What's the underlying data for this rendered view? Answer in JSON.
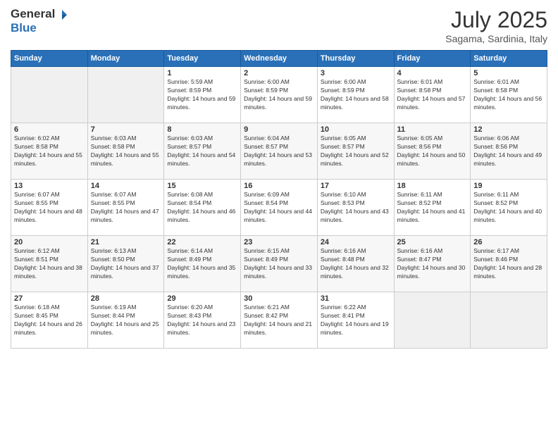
{
  "header": {
    "logo": {
      "general": "General",
      "blue": "Blue"
    },
    "title": "July 2025",
    "subtitle": "Sagama, Sardinia, Italy"
  },
  "calendar": {
    "days": [
      "Sunday",
      "Monday",
      "Tuesday",
      "Wednesday",
      "Thursday",
      "Friday",
      "Saturday"
    ],
    "weeks": [
      [
        {
          "day": null
        },
        {
          "day": null
        },
        {
          "day": 1,
          "sunrise": "5:59 AM",
          "sunset": "8:59 PM",
          "daylight": "14 hours and 59 minutes."
        },
        {
          "day": 2,
          "sunrise": "6:00 AM",
          "sunset": "8:59 PM",
          "daylight": "14 hours and 59 minutes."
        },
        {
          "day": 3,
          "sunrise": "6:00 AM",
          "sunset": "8:59 PM",
          "daylight": "14 hours and 58 minutes."
        },
        {
          "day": 4,
          "sunrise": "6:01 AM",
          "sunset": "8:58 PM",
          "daylight": "14 hours and 57 minutes."
        },
        {
          "day": 5,
          "sunrise": "6:01 AM",
          "sunset": "8:58 PM",
          "daylight": "14 hours and 56 minutes."
        }
      ],
      [
        {
          "day": 6,
          "sunrise": "6:02 AM",
          "sunset": "8:58 PM",
          "daylight": "14 hours and 55 minutes."
        },
        {
          "day": 7,
          "sunrise": "6:03 AM",
          "sunset": "8:58 PM",
          "daylight": "14 hours and 55 minutes."
        },
        {
          "day": 8,
          "sunrise": "6:03 AM",
          "sunset": "8:57 PM",
          "daylight": "14 hours and 54 minutes."
        },
        {
          "day": 9,
          "sunrise": "6:04 AM",
          "sunset": "8:57 PM",
          "daylight": "14 hours and 53 minutes."
        },
        {
          "day": 10,
          "sunrise": "6:05 AM",
          "sunset": "8:57 PM",
          "daylight": "14 hours and 52 minutes."
        },
        {
          "day": 11,
          "sunrise": "6:05 AM",
          "sunset": "8:56 PM",
          "daylight": "14 hours and 50 minutes."
        },
        {
          "day": 12,
          "sunrise": "6:06 AM",
          "sunset": "8:56 PM",
          "daylight": "14 hours and 49 minutes."
        }
      ],
      [
        {
          "day": 13,
          "sunrise": "6:07 AM",
          "sunset": "8:55 PM",
          "daylight": "14 hours and 48 minutes."
        },
        {
          "day": 14,
          "sunrise": "6:07 AM",
          "sunset": "8:55 PM",
          "daylight": "14 hours and 47 minutes."
        },
        {
          "day": 15,
          "sunrise": "6:08 AM",
          "sunset": "8:54 PM",
          "daylight": "14 hours and 46 minutes."
        },
        {
          "day": 16,
          "sunrise": "6:09 AM",
          "sunset": "8:54 PM",
          "daylight": "14 hours and 44 minutes."
        },
        {
          "day": 17,
          "sunrise": "6:10 AM",
          "sunset": "8:53 PM",
          "daylight": "14 hours and 43 minutes."
        },
        {
          "day": 18,
          "sunrise": "6:11 AM",
          "sunset": "8:52 PM",
          "daylight": "14 hours and 41 minutes."
        },
        {
          "day": 19,
          "sunrise": "6:11 AM",
          "sunset": "8:52 PM",
          "daylight": "14 hours and 40 minutes."
        }
      ],
      [
        {
          "day": 20,
          "sunrise": "6:12 AM",
          "sunset": "8:51 PM",
          "daylight": "14 hours and 38 minutes."
        },
        {
          "day": 21,
          "sunrise": "6:13 AM",
          "sunset": "8:50 PM",
          "daylight": "14 hours and 37 minutes."
        },
        {
          "day": 22,
          "sunrise": "6:14 AM",
          "sunset": "8:49 PM",
          "daylight": "14 hours and 35 minutes."
        },
        {
          "day": 23,
          "sunrise": "6:15 AM",
          "sunset": "8:49 PM",
          "daylight": "14 hours and 33 minutes."
        },
        {
          "day": 24,
          "sunrise": "6:16 AM",
          "sunset": "8:48 PM",
          "daylight": "14 hours and 32 minutes."
        },
        {
          "day": 25,
          "sunrise": "6:16 AM",
          "sunset": "8:47 PM",
          "daylight": "14 hours and 30 minutes."
        },
        {
          "day": 26,
          "sunrise": "6:17 AM",
          "sunset": "8:46 PM",
          "daylight": "14 hours and 28 minutes."
        }
      ],
      [
        {
          "day": 27,
          "sunrise": "6:18 AM",
          "sunset": "8:45 PM",
          "daylight": "14 hours and 26 minutes."
        },
        {
          "day": 28,
          "sunrise": "6:19 AM",
          "sunset": "8:44 PM",
          "daylight": "14 hours and 25 minutes."
        },
        {
          "day": 29,
          "sunrise": "6:20 AM",
          "sunset": "8:43 PM",
          "daylight": "14 hours and 23 minutes."
        },
        {
          "day": 30,
          "sunrise": "6:21 AM",
          "sunset": "8:42 PM",
          "daylight": "14 hours and 21 minutes."
        },
        {
          "day": 31,
          "sunrise": "6:22 AM",
          "sunset": "8:41 PM",
          "daylight": "14 hours and 19 minutes."
        },
        {
          "day": null
        },
        {
          "day": null
        }
      ]
    ]
  }
}
